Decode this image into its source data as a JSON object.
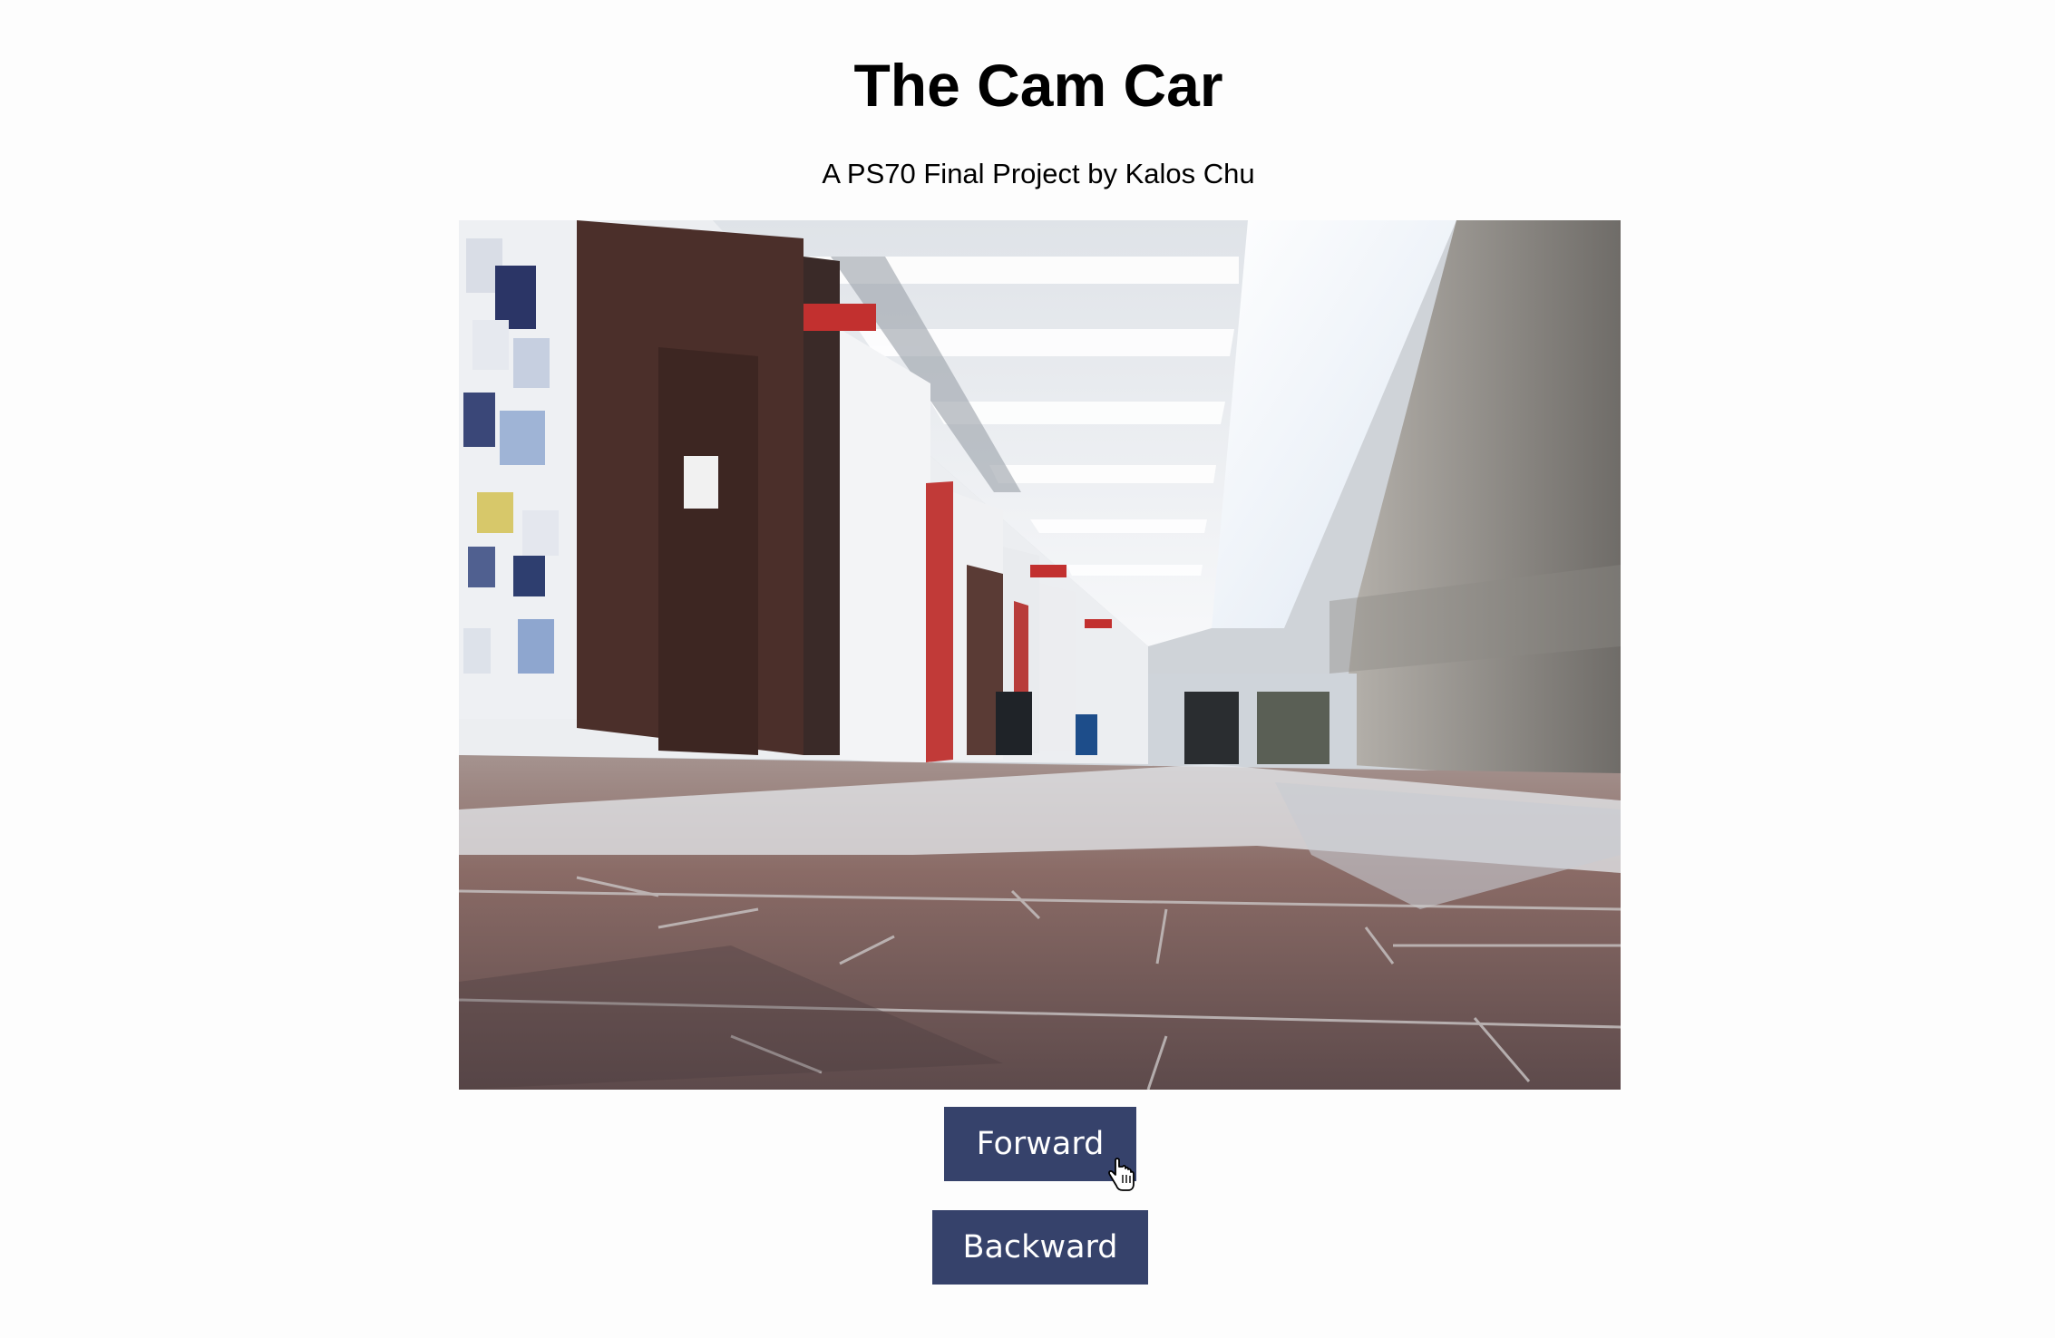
{
  "page": {
    "title": "The Cam Car",
    "subtitle": "A PS70 Final Project by Kalos Chu"
  },
  "camera": {
    "icon": "camera-feed-image",
    "description_colors": {
      "floor": "#7a5a55",
      "wall": "#e8eaee",
      "door": "#c23a3a",
      "sky": "#f2f6fb"
    }
  },
  "controls": {
    "forward_label": "Forward",
    "backward_label": "Backward",
    "button_color": "#36426b"
  },
  "cursor": {
    "icon": "hand-pointer-icon"
  }
}
